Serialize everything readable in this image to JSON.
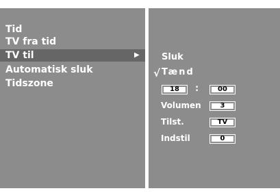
{
  "menu": {
    "items": [
      {
        "label": "Tid"
      },
      {
        "label": "TV fra tid"
      },
      {
        "label": "TV til"
      },
      {
        "label": "Automatisk sluk"
      },
      {
        "label": "Tidszone"
      }
    ],
    "selected_index": 2,
    "submenu_arrow": "right-triangle-icon"
  },
  "submenu": {
    "options": [
      {
        "label": "Sluk",
        "checked": false
      },
      {
        "label": "Tænd",
        "checked": true
      }
    ],
    "check_glyph": "√",
    "time": {
      "hour": "18",
      "separator": ":",
      "minute": "00"
    },
    "volume": {
      "label": "Volumen",
      "value": "3"
    },
    "input": {
      "label": "Tilst.",
      "value": "TV"
    },
    "program": {
      "label": "Indstil",
      "value": "0"
    }
  },
  "colors": {
    "panel": "#8c8c8c",
    "selected": "#666666",
    "text": "#ffffff"
  }
}
